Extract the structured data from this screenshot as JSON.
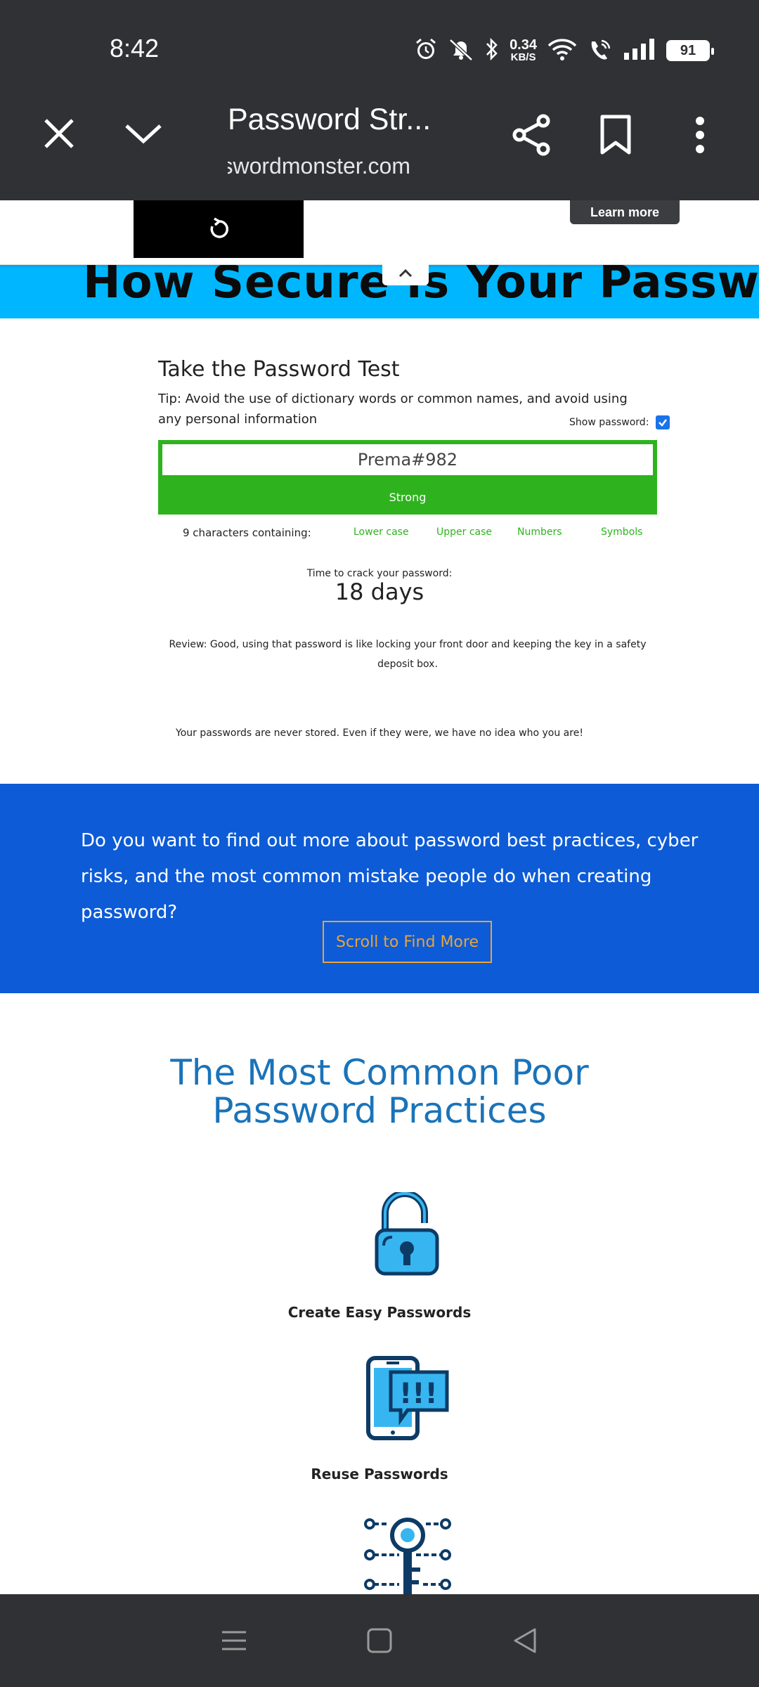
{
  "status_bar": {
    "time": "8:42",
    "net_speed": "0.34",
    "net_unit": "KB/S",
    "battery": "91",
    "icons": [
      "alarm-icon",
      "mute-icon",
      "bluetooth-icon",
      "wifi-icon",
      "wifi-call-icon",
      "signal-icon"
    ]
  },
  "browser": {
    "tab_title": "Password Str...",
    "url": "passwordmonster.com",
    "icons": [
      "close-icon",
      "chevron-down-icon",
      "share-icon",
      "bookmark-icon",
      "more-vert-icon"
    ]
  },
  "ad": {
    "learn_more": "Learn more",
    "icons": [
      "replay-icon",
      "chevron-up-icon"
    ]
  },
  "hero": {
    "title": "How Secure is Your Password?"
  },
  "test": {
    "title": "Take the Password Test",
    "tip": "Tip: Avoid the use of dictionary words or common names, and avoid using any personal information",
    "show_password_label": "Show password:",
    "password_value": "Prema#982",
    "strength": "Strong",
    "chars_label": "9 characters containing:",
    "criteria": [
      "Lower case",
      "Upper case",
      "Numbers",
      "Symbols"
    ],
    "crack_label": "Time to crack your password:",
    "crack_value": "18 days",
    "review": "Review: Good, using that password is like locking your front door and keeping the key in a safety deposit box.",
    "privacy": "Your passwords are never stored. Even if they were, we have no idea who you are!"
  },
  "cta": {
    "text": "Do you want to find out more about password best practices, cyber risks, and the most common mistake people do when creating password?",
    "button": "Scroll to Find More"
  },
  "practices": {
    "title": "The Most Common Poor Password Practices",
    "items": [
      {
        "label": "Create Easy Passwords",
        "icon": "unlocked-padlock-icon"
      },
      {
        "label": "Reuse Passwords",
        "icon": "phone-alert-icon"
      },
      {
        "label": "",
        "icon": "circuit-key-icon"
      }
    ]
  },
  "colors": {
    "hero_bg": "#00b7ff",
    "strong_green": "#2eb31e",
    "cta_bg": "#0d5bd6",
    "cta_button": "#e7a43a",
    "heading_blue": "#1a73b9"
  },
  "navbar": {
    "icons": [
      "menu-icon",
      "home-square-icon",
      "back-triangle-icon"
    ]
  }
}
